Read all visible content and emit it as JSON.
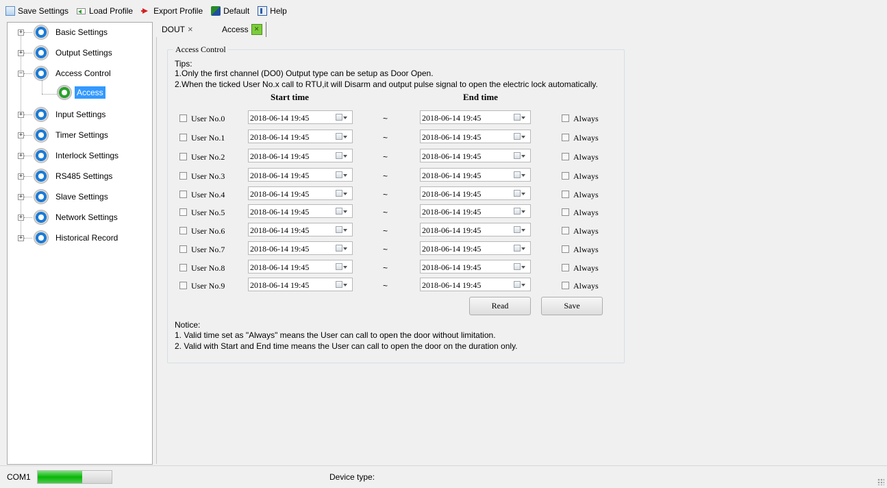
{
  "toolbar": {
    "save_settings": "Save Settings",
    "load_profile": "Load Profile",
    "export_profile": "Export Profile",
    "default": "Default",
    "help": "Help"
  },
  "sidebar": {
    "items": [
      {
        "label": "Basic Settings",
        "expander": "+",
        "icon": "settings-disc-icon"
      },
      {
        "label": "Output Settings",
        "expander": "+",
        "icon": "settings-disc-icon"
      },
      {
        "label": "Access Control",
        "expander": "−",
        "icon": "settings-disc-icon"
      },
      {
        "label": "Access",
        "expander": "",
        "icon": "gear-icon",
        "selected": true
      },
      {
        "label": "Input Settings",
        "expander": "+",
        "icon": "settings-disc-icon"
      },
      {
        "label": "Timer Settings",
        "expander": "+",
        "icon": "settings-disc-icon"
      },
      {
        "label": "Interlock Settings",
        "expander": "+",
        "icon": "settings-disc-icon"
      },
      {
        "label": "RS485 Settings",
        "expander": "+",
        "icon": "settings-disc-icon"
      },
      {
        "label": "Slave Settings",
        "expander": "+",
        "icon": "settings-disc-icon"
      },
      {
        "label": "Network Settings",
        "expander": "+",
        "icon": "settings-disc-icon"
      },
      {
        "label": "Historical Record",
        "expander": "+",
        "icon": "settings-disc-icon"
      }
    ]
  },
  "tabs": [
    {
      "label": "DOUT",
      "close": "×",
      "active": false
    },
    {
      "label": "Access",
      "close": "×",
      "active": true
    }
  ],
  "access": {
    "group_title": "Access Control",
    "tips_title": "Tips:",
    "tip1": "1.Only the first channel (DO0) Output type can be setup as Door Open.",
    "tip2": "2.When the ticked User No.x call to RTU,it will Disarm and output pulse signal to open the electric lock automatically.",
    "start_header": "Start time",
    "end_header": "End time",
    "separator": "~",
    "always_label": "Always",
    "users": [
      {
        "label": "User No.0",
        "start": "2018-06-14 19:45",
        "end": "2018-06-14 19:45"
      },
      {
        "label": "User No.1",
        "start": "2018-06-14 19:45",
        "end": "2018-06-14 19:45"
      },
      {
        "label": "User No.2",
        "start": "2018-06-14 19:45",
        "end": "2018-06-14 19:45"
      },
      {
        "label": "User No.3",
        "start": "2018-06-14 19:45",
        "end": "2018-06-14 19:45"
      },
      {
        "label": "User No.4",
        "start": "2018-06-14 19:45",
        "end": "2018-06-14 19:45"
      },
      {
        "label": "User No.5",
        "start": "2018-06-14 19:45",
        "end": "2018-06-14 19:45"
      },
      {
        "label": "User No.6",
        "start": "2018-06-14 19:45",
        "end": "2018-06-14 19:45"
      },
      {
        "label": "User No.7",
        "start": "2018-06-14 19:45",
        "end": "2018-06-14 19:45"
      },
      {
        "label": "User No.8",
        "start": "2018-06-14 19:45",
        "end": "2018-06-14 19:45"
      },
      {
        "label": "User No.9",
        "start": "2018-06-14 19:45",
        "end": "2018-06-14 19:45"
      }
    ],
    "read_button": "Read",
    "save_button": "Save",
    "notice_title": "Notice:",
    "notice1": "1. Valid time set as \"Always\" means the User can call to open the door without limitation.",
    "notice2": "2. Valid with Start and End time means the User can call to open the door on the duration only."
  },
  "statusbar": {
    "com_label": "COM1",
    "progress_fraction": 0.6,
    "device_type_label": "Device type:"
  }
}
